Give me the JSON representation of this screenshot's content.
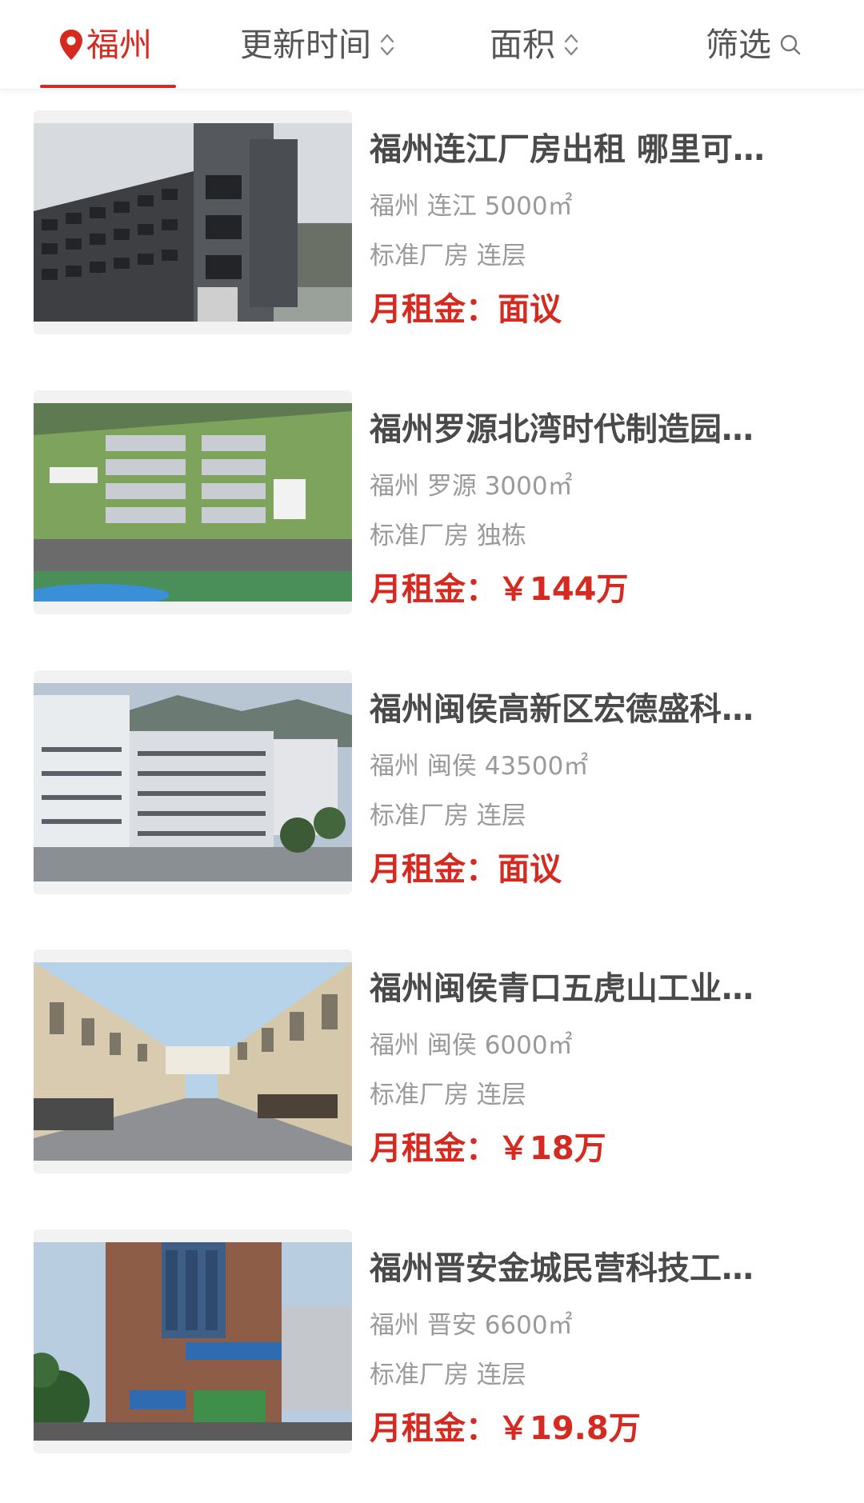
{
  "filter_bar": {
    "city": "福州",
    "sort_time": "更新时间",
    "sort_area": "面积",
    "filter": "筛选"
  },
  "colors": {
    "accent": "#d62a20",
    "title_text": "#4a4a4a",
    "meta_text": "#9a9a9a"
  },
  "listings": [
    {
      "title": "福州连江厂房出租 哪里可…",
      "location": "福州 连江 5000㎡",
      "type": "标准厂房 连层",
      "rent_label": "月租金：",
      "rent_value": "面议"
    },
    {
      "title": "福州罗源北湾时代制造园…",
      "location": "福州 罗源 3000㎡",
      "type": "标准厂房 独栋",
      "rent_label": "月租金：",
      "rent_value": "￥144万"
    },
    {
      "title": "福州闽侯高新区宏德盛科…",
      "location": "福州 闽侯 43500㎡",
      "type": "标准厂房 连层",
      "rent_label": "月租金：",
      "rent_value": "面议"
    },
    {
      "title": "福州闽侯青口五虎山工业…",
      "location": "福州 闽侯 6000㎡",
      "type": "标准厂房 连层",
      "rent_label": "月租金：",
      "rent_value": "￥18万"
    },
    {
      "title": "福州晋安金城民营科技工…",
      "location": "福州 晋安 6600㎡",
      "type": "标准厂房 连层",
      "rent_label": "月租金：",
      "rent_value": "￥19.8万"
    }
  ]
}
